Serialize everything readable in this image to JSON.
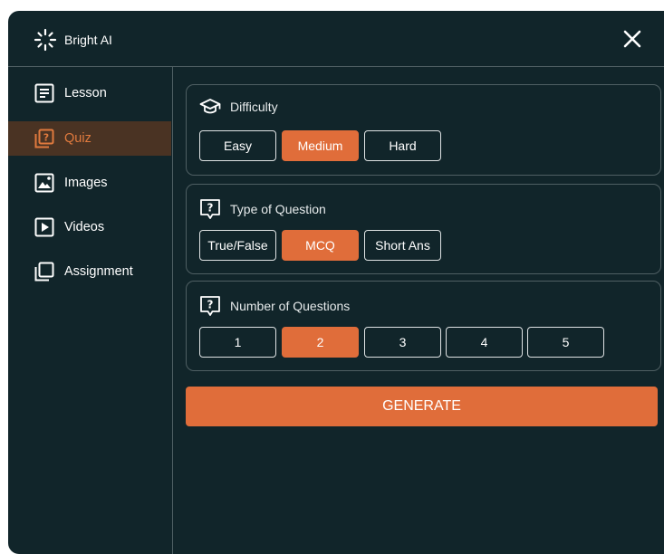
{
  "app": {
    "brand": "Bright AI"
  },
  "sidebar": {
    "items": [
      {
        "label": "Lesson",
        "icon": "lesson-icon"
      },
      {
        "label": "Quiz",
        "icon": "quiz-icon",
        "active": true
      },
      {
        "label": "Images",
        "icon": "image-icon"
      },
      {
        "label": "Videos",
        "icon": "video-icon"
      },
      {
        "label": "Assignment",
        "icon": "assignment-icon"
      }
    ]
  },
  "quiz": {
    "difficulty": {
      "title": "Difficulty",
      "options": [
        "Easy",
        "Medium",
        "Hard"
      ],
      "selected": "Medium"
    },
    "question_type": {
      "title": "Type of Question",
      "options": [
        "True/False",
        "MCQ",
        "Short Ans"
      ],
      "selected": "MCQ"
    },
    "question_count": {
      "title": "Number of Questions",
      "options": [
        "1",
        "2",
        "3",
        "4",
        "5"
      ],
      "selected": "2"
    },
    "generate_label": "GENERATE"
  },
  "colors": {
    "panel_bg": "#11252a",
    "accent": "#e06d3a",
    "active_row_bg": "#4a3323",
    "border": "#4f5f63"
  }
}
